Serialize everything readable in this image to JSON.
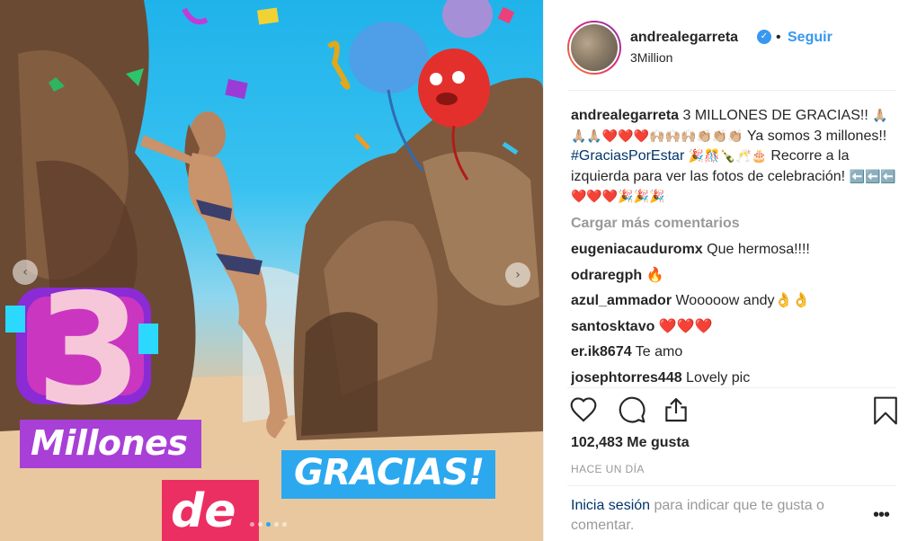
{
  "post": {
    "username": "andrealegarreta",
    "verified_icon": "verified-badge-icon",
    "bullet": "•",
    "follow_label": "Seguir",
    "location": "3Million"
  },
  "media": {
    "prev_arrow": "‹",
    "next_arrow": "›",
    "sticker_number": "3",
    "sticker_millones": "Millones",
    "sticker_de": "de",
    "sticker_gracias": "GRACIAS!",
    "carousel_total": 5,
    "carousel_active": 3
  },
  "caption": {
    "username": "andrealegarreta",
    "text_1": " 3 MILLONES DE GRACIAS!! ",
    "emoji_1": "🙏🏼🙏🏼🙏🏼❤️❤️❤️🙌🏼🙌🏼🙌🏼👏🏼👏🏼👏🏼",
    "text_2": " Ya somos 3 millones!! ",
    "hashtag": "#GraciasPorEstar",
    "emoji_2": " 🎉🎊🍾🥂🎂",
    "text_3": " Recorre a la izquierda para ver las fotos de celebración! ",
    "emoji_3": "⬅️⬅️⬅️ ❤️❤️❤️🎉🎉🎉"
  },
  "load_more_label": "Cargar más comentarios",
  "comments": [
    {
      "user": "eugeniacauduromx",
      "text": " Que hermosa!!!!"
    },
    {
      "user": "odraregph",
      "text": " 🔥"
    },
    {
      "user": "azul_ammador",
      "text": " Wooooow andy👌👌"
    },
    {
      "user": "santosktavo",
      "text": " ❤️❤️❤️"
    },
    {
      "user": "er.ik8674",
      "text": " Te amo"
    },
    {
      "user": "josephtorres448",
      "text": " Lovely pic"
    }
  ],
  "actions": {
    "like_icon": "heart-icon",
    "comment_icon": "comment-icon",
    "share_icon": "share-icon",
    "save_icon": "bookmark-icon"
  },
  "likes_text": "102,483 Me gusta",
  "timestamp": "HACE UN DÍA",
  "login": {
    "link": "Inicia sesión",
    "rest": " para indicar que te gusta o comentar."
  },
  "more_label": "•••"
}
